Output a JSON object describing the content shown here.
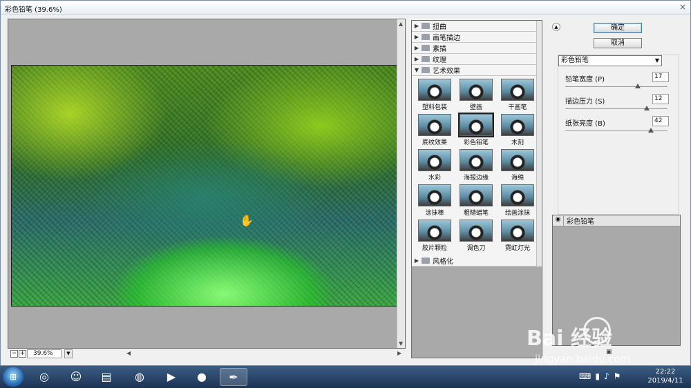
{
  "window": {
    "title": "彩色铅笔 (39.6%)"
  },
  "preview": {
    "zoom_value": "39.6%",
    "zoom_minus": "−",
    "zoom_plus": "+"
  },
  "gallery": {
    "folders_top": [
      "扭曲",
      "画笔描边",
      "素描",
      "纹理"
    ],
    "open_folder": "艺术效果",
    "filters": [
      "塑料包装",
      "壁画",
      "干画笔",
      "底纹效果",
      "彩色铅笔",
      "木刻",
      "水彩",
      "海报边缘",
      "海绵",
      "涂抹棒",
      "粗糙蜡笔",
      "绘画涂抹",
      "胶片颗粒",
      "调色刀",
      "霓虹灯光"
    ],
    "selected_filter": "彩色铅笔",
    "folder_bottom": "风格化"
  },
  "buttons": {
    "ok": "确定",
    "cancel": "取消"
  },
  "settings": {
    "filter_select": "彩色铅笔",
    "params": [
      {
        "label": "铅笔宽度 (P)",
        "value": "17",
        "level": 0.71
      },
      {
        "label": "描边压力 (S)",
        "value": "12",
        "level": 0.8
      },
      {
        "label": "纸张亮度 (B)",
        "value": "42",
        "level": 0.84
      }
    ]
  },
  "layers": {
    "current": "彩色铅笔"
  },
  "watermark": {
    "main": "Bai  经验",
    "sub": "jingyan.baidu.com"
  },
  "taskbar": {
    "time": "22:22",
    "date": "2019/4/11"
  }
}
